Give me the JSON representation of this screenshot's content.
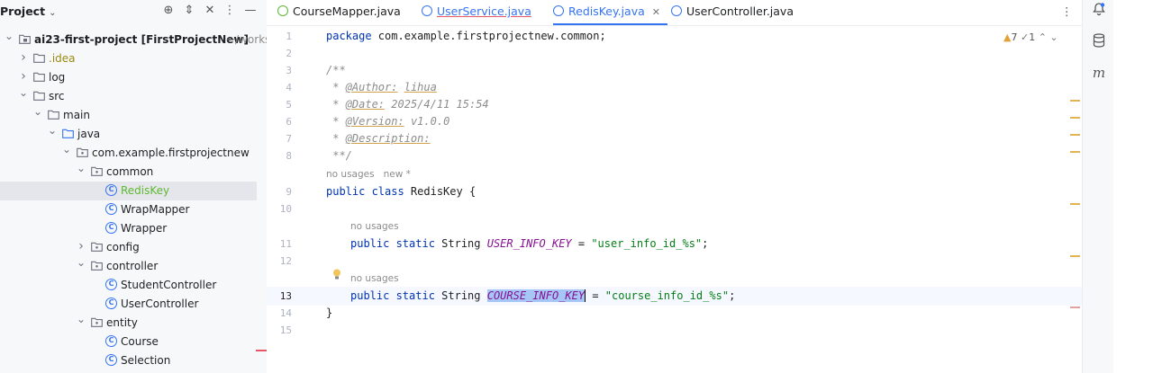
{
  "project_panel": {
    "title": "Project",
    "tree": [
      {
        "label": "ai23-first-project [FirstProjectNew]",
        "suffix": "~/workspace",
        "kind": "module",
        "arrow": "down"
      },
      {
        "label": ".idea",
        "kind": "folder",
        "arrow": "right"
      },
      {
        "label": "log",
        "kind": "folder",
        "arrow": "right"
      },
      {
        "label": "src",
        "kind": "folder",
        "arrow": "down"
      },
      {
        "label": "main",
        "kind": "folder",
        "arrow": "down"
      },
      {
        "label": "java",
        "kind": "source-folder",
        "arrow": "down"
      },
      {
        "label": "com.example.firstprojectnew",
        "kind": "package",
        "arrow": "down"
      },
      {
        "label": "common",
        "kind": "package",
        "arrow": "down"
      },
      {
        "label": "RedisKey",
        "kind": "class",
        "selected": true
      },
      {
        "label": "WrapMapper",
        "kind": "class"
      },
      {
        "label": "Wrapper",
        "kind": "class"
      },
      {
        "label": "config",
        "kind": "package",
        "arrow": "right"
      },
      {
        "label": "controller",
        "kind": "package",
        "arrow": "down"
      },
      {
        "label": "StudentController",
        "kind": "class"
      },
      {
        "label": "UserController",
        "kind": "class"
      },
      {
        "label": "entity",
        "kind": "package",
        "arrow": "down"
      },
      {
        "label": "Course",
        "kind": "class"
      },
      {
        "label": "Selection",
        "kind": "class"
      }
    ]
  },
  "tabs": [
    {
      "label": "CourseMapper.java",
      "icon": "interface-icon",
      "color": "#5fb832"
    },
    {
      "label": "UserService.java",
      "icon": "class-icon",
      "color": "#3574f0"
    },
    {
      "label": "RedisKey.java",
      "icon": "class-icon",
      "color": "#3574f0",
      "active": true,
      "close": "✕"
    },
    {
      "label": "UserController.java",
      "icon": "class-icon",
      "color": "#3574f0"
    }
  ],
  "inspections": {
    "warnings": "7",
    "weak_warnings": "1"
  },
  "code": {
    "line_numbers": [
      "1",
      "2",
      "3",
      "4",
      "5",
      "6",
      "7",
      "8",
      "9",
      "10",
      "11",
      "12",
      "13",
      "14",
      "15"
    ],
    "current_line": "13",
    "package_kw": "package",
    "package_name": " com.example.firstprojectnew.common;",
    "doc_open": "/**",
    "author_tag": "@Author:",
    "author_val": "lihua",
    "date_tag": "@Date:",
    "date_val": "2025/4/11 15:54",
    "version_tag": "@Version:",
    "version_val": "v1.0.0",
    "desc_tag": "@Description:",
    "doc_close": "**/",
    "hint_class": "no usages   new *",
    "class_kw": "public class",
    "class_name": " RedisKey {",
    "hint_field1": "no usages",
    "field1_kw": "public static",
    "field1_type": " String ",
    "field1_name": "USER_INFO_KEY",
    "field1_eq": " = ",
    "field1_val": "\"user_info_id_%s\"",
    "field1_end": ";",
    "hint_field2": "no usages",
    "field2_kw": "public static",
    "field2_type": " String ",
    "field2_name": "COURSE_INFO_KEY",
    "field2_eq": " = ",
    "field2_val": "\"course_info_id_%s\"",
    "field2_end": ";",
    "close_brace": "}"
  },
  "colors": {
    "accent": "#3574f0",
    "selection": "#a6c6f5"
  }
}
